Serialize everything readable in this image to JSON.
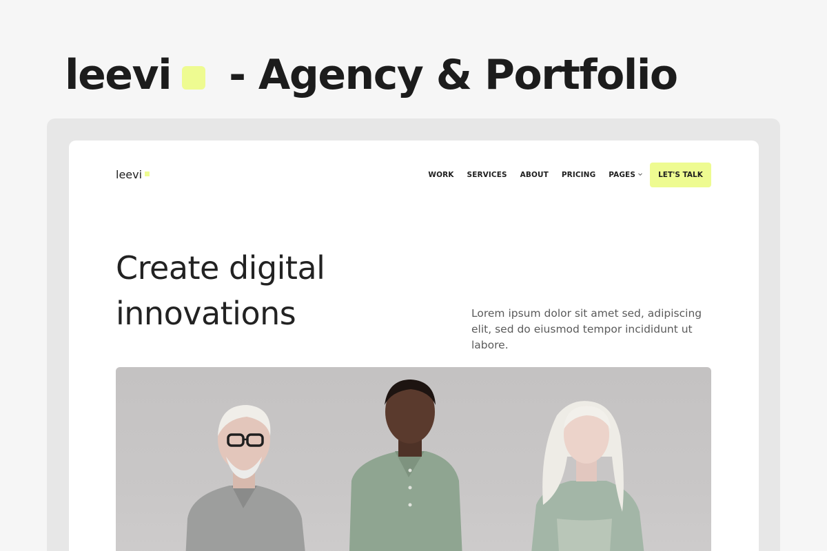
{
  "promo": {
    "brand": "leevi",
    "subtitle": "- Agency & Portfolio",
    "accent_color": "#eefb91"
  },
  "site": {
    "logo": "leevi",
    "nav": {
      "items": [
        "WORK",
        "SERVICES",
        "ABOUT",
        "PRICING"
      ],
      "pages_label": "PAGES",
      "cta_label": "LET'S TALK"
    },
    "hero": {
      "title_line1": "Create digital",
      "title_line2": "innovations",
      "description": "Lorem ipsum dolor sit amet sed, adipiscing elit, sed do eiusmod tempor incididunt ut labore."
    },
    "image": {
      "subject": "three-people-portrait"
    }
  }
}
